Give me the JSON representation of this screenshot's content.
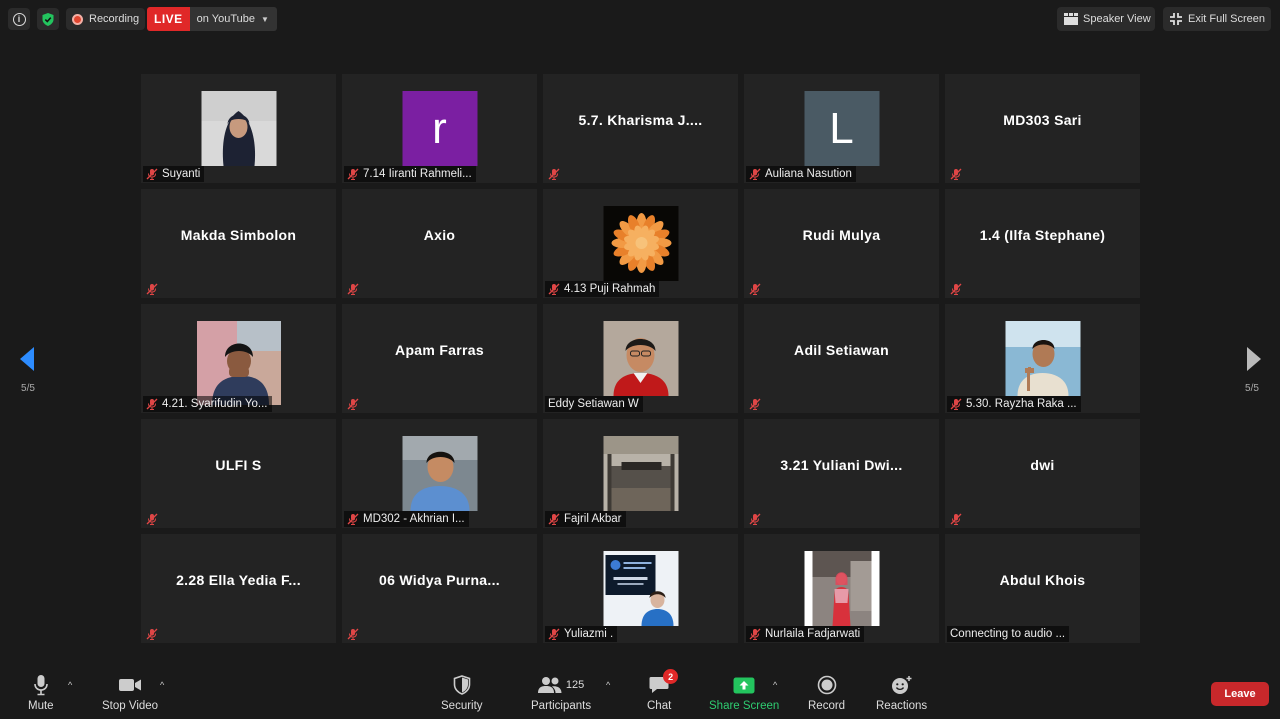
{
  "topbar": {
    "recording_label": "Recording",
    "live_label": "LIVE",
    "live_destination": "on YouTube",
    "speaker_view_label": "Speaker View",
    "exit_full_screen_label": "Exit Full Screen"
  },
  "nav": {
    "page_indicator": "5/5"
  },
  "tiles": [
    {
      "name": "Suyanti",
      "display": "video",
      "video": "woman-hijab"
    },
    {
      "name": "7.14 Iiranti Rahmeli...",
      "display": "letter",
      "letter": "r",
      "color": "#7b1fa2"
    },
    {
      "name": "",
      "center": "5.7. Kharisma J...."
    },
    {
      "name": "Auliana Nasution",
      "display": "letter",
      "letter": "L",
      "color": "#4a5a64"
    },
    {
      "name": "",
      "center": "MD303 Sari"
    },
    {
      "name": "",
      "center": "Makda Simbolon"
    },
    {
      "name": "",
      "center": "Axio"
    },
    {
      "name": "4.13 Puji Rahmah",
      "display": "video",
      "video": "flower"
    },
    {
      "name": "",
      "center": "Rudi Mulya"
    },
    {
      "name": "",
      "center": "1.4 (Ilfa Stephane)"
    },
    {
      "name": "4.21. Syarifudin Yo...",
      "display": "video",
      "video": "boy"
    },
    {
      "name": "",
      "center": "Apam Farras"
    },
    {
      "name": "Eddy Setiawan W",
      "display": "video",
      "video": "man-red",
      "muted": false
    },
    {
      "name": "",
      "center": "Adil Setiawan"
    },
    {
      "name": "5.30. Rayzha Raka ...",
      "display": "video",
      "video": "teen-wave"
    },
    {
      "name": "",
      "center": "ULFI S"
    },
    {
      "name": "MD302 - Akhrian I...",
      "display": "video",
      "video": "man-blue"
    },
    {
      "name": "Fajril Akbar",
      "display": "video",
      "video": "room"
    },
    {
      "name": "",
      "center": "3.21 Yuliani Dwi..."
    },
    {
      "name": "",
      "center": "dwi"
    },
    {
      "name": "",
      "center": "2.28 Ella Yedia F..."
    },
    {
      "name": "",
      "center": "06 Widya Purna..."
    },
    {
      "name": "Yuliazmi .",
      "display": "video",
      "video": "slide-woman"
    },
    {
      "name": "Nurlaila Fadjarwati",
      "display": "video",
      "video": "woman-pink"
    },
    {
      "name": "Connecting to audio ...",
      "center": "Abdul Khois",
      "muted": false
    }
  ],
  "toolbar": {
    "mute_label": "Mute",
    "stop_video_label": "Stop Video",
    "security_label": "Security",
    "participants_label": "Participants",
    "participants_count": "125",
    "chat_label": "Chat",
    "chat_badge": "2",
    "share_screen_label": "Share Screen",
    "record_label": "Record",
    "reactions_label": "Reactions",
    "leave_label": "Leave"
  }
}
